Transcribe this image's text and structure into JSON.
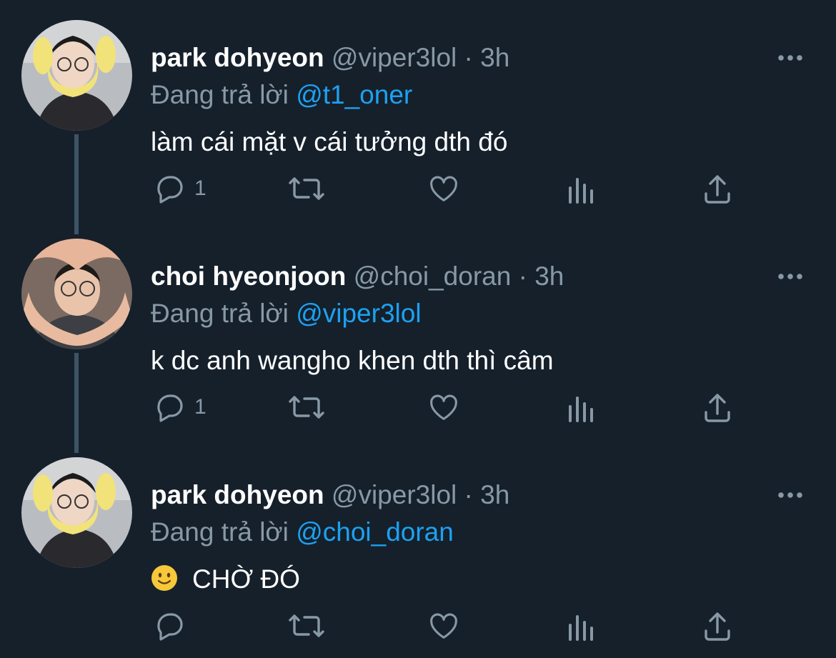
{
  "theme": {
    "background": "#15202b",
    "primary_text": "#ffffff",
    "secondary_text": "#8899a6",
    "link": "#1da1f2",
    "thread_line": "#3d5466"
  },
  "tweets": [
    {
      "name": "park dohyeon",
      "handle": "@viper3lol",
      "separator": "·",
      "time": "3h",
      "reply_prefix": "Đang trả lời",
      "reply_to": "@t1_oner",
      "text": "làm cái mặt v cái tưởng dth đó",
      "emoji": "",
      "reply_count": "1",
      "avatar": "yellow-headband-avatar"
    },
    {
      "name": "choi hyeonjoon",
      "handle": "@choi_doran",
      "separator": "·",
      "time": "3h",
      "reply_prefix": "Đang trả lời",
      "reply_to": "@viper3lol",
      "text": "k dc anh wangho khen dth thì câm",
      "emoji": "",
      "reply_count": "1",
      "avatar": "heart-hands-avatar"
    },
    {
      "name": "park dohyeon",
      "handle": "@viper3lol",
      "separator": "·",
      "time": "3h",
      "reply_prefix": "Đang trả lời",
      "reply_to": "@choi_doran",
      "text": "CHỜ ĐÓ",
      "emoji": "slightly-smiling-face",
      "reply_count": "",
      "avatar": "yellow-headband-avatar"
    }
  ]
}
